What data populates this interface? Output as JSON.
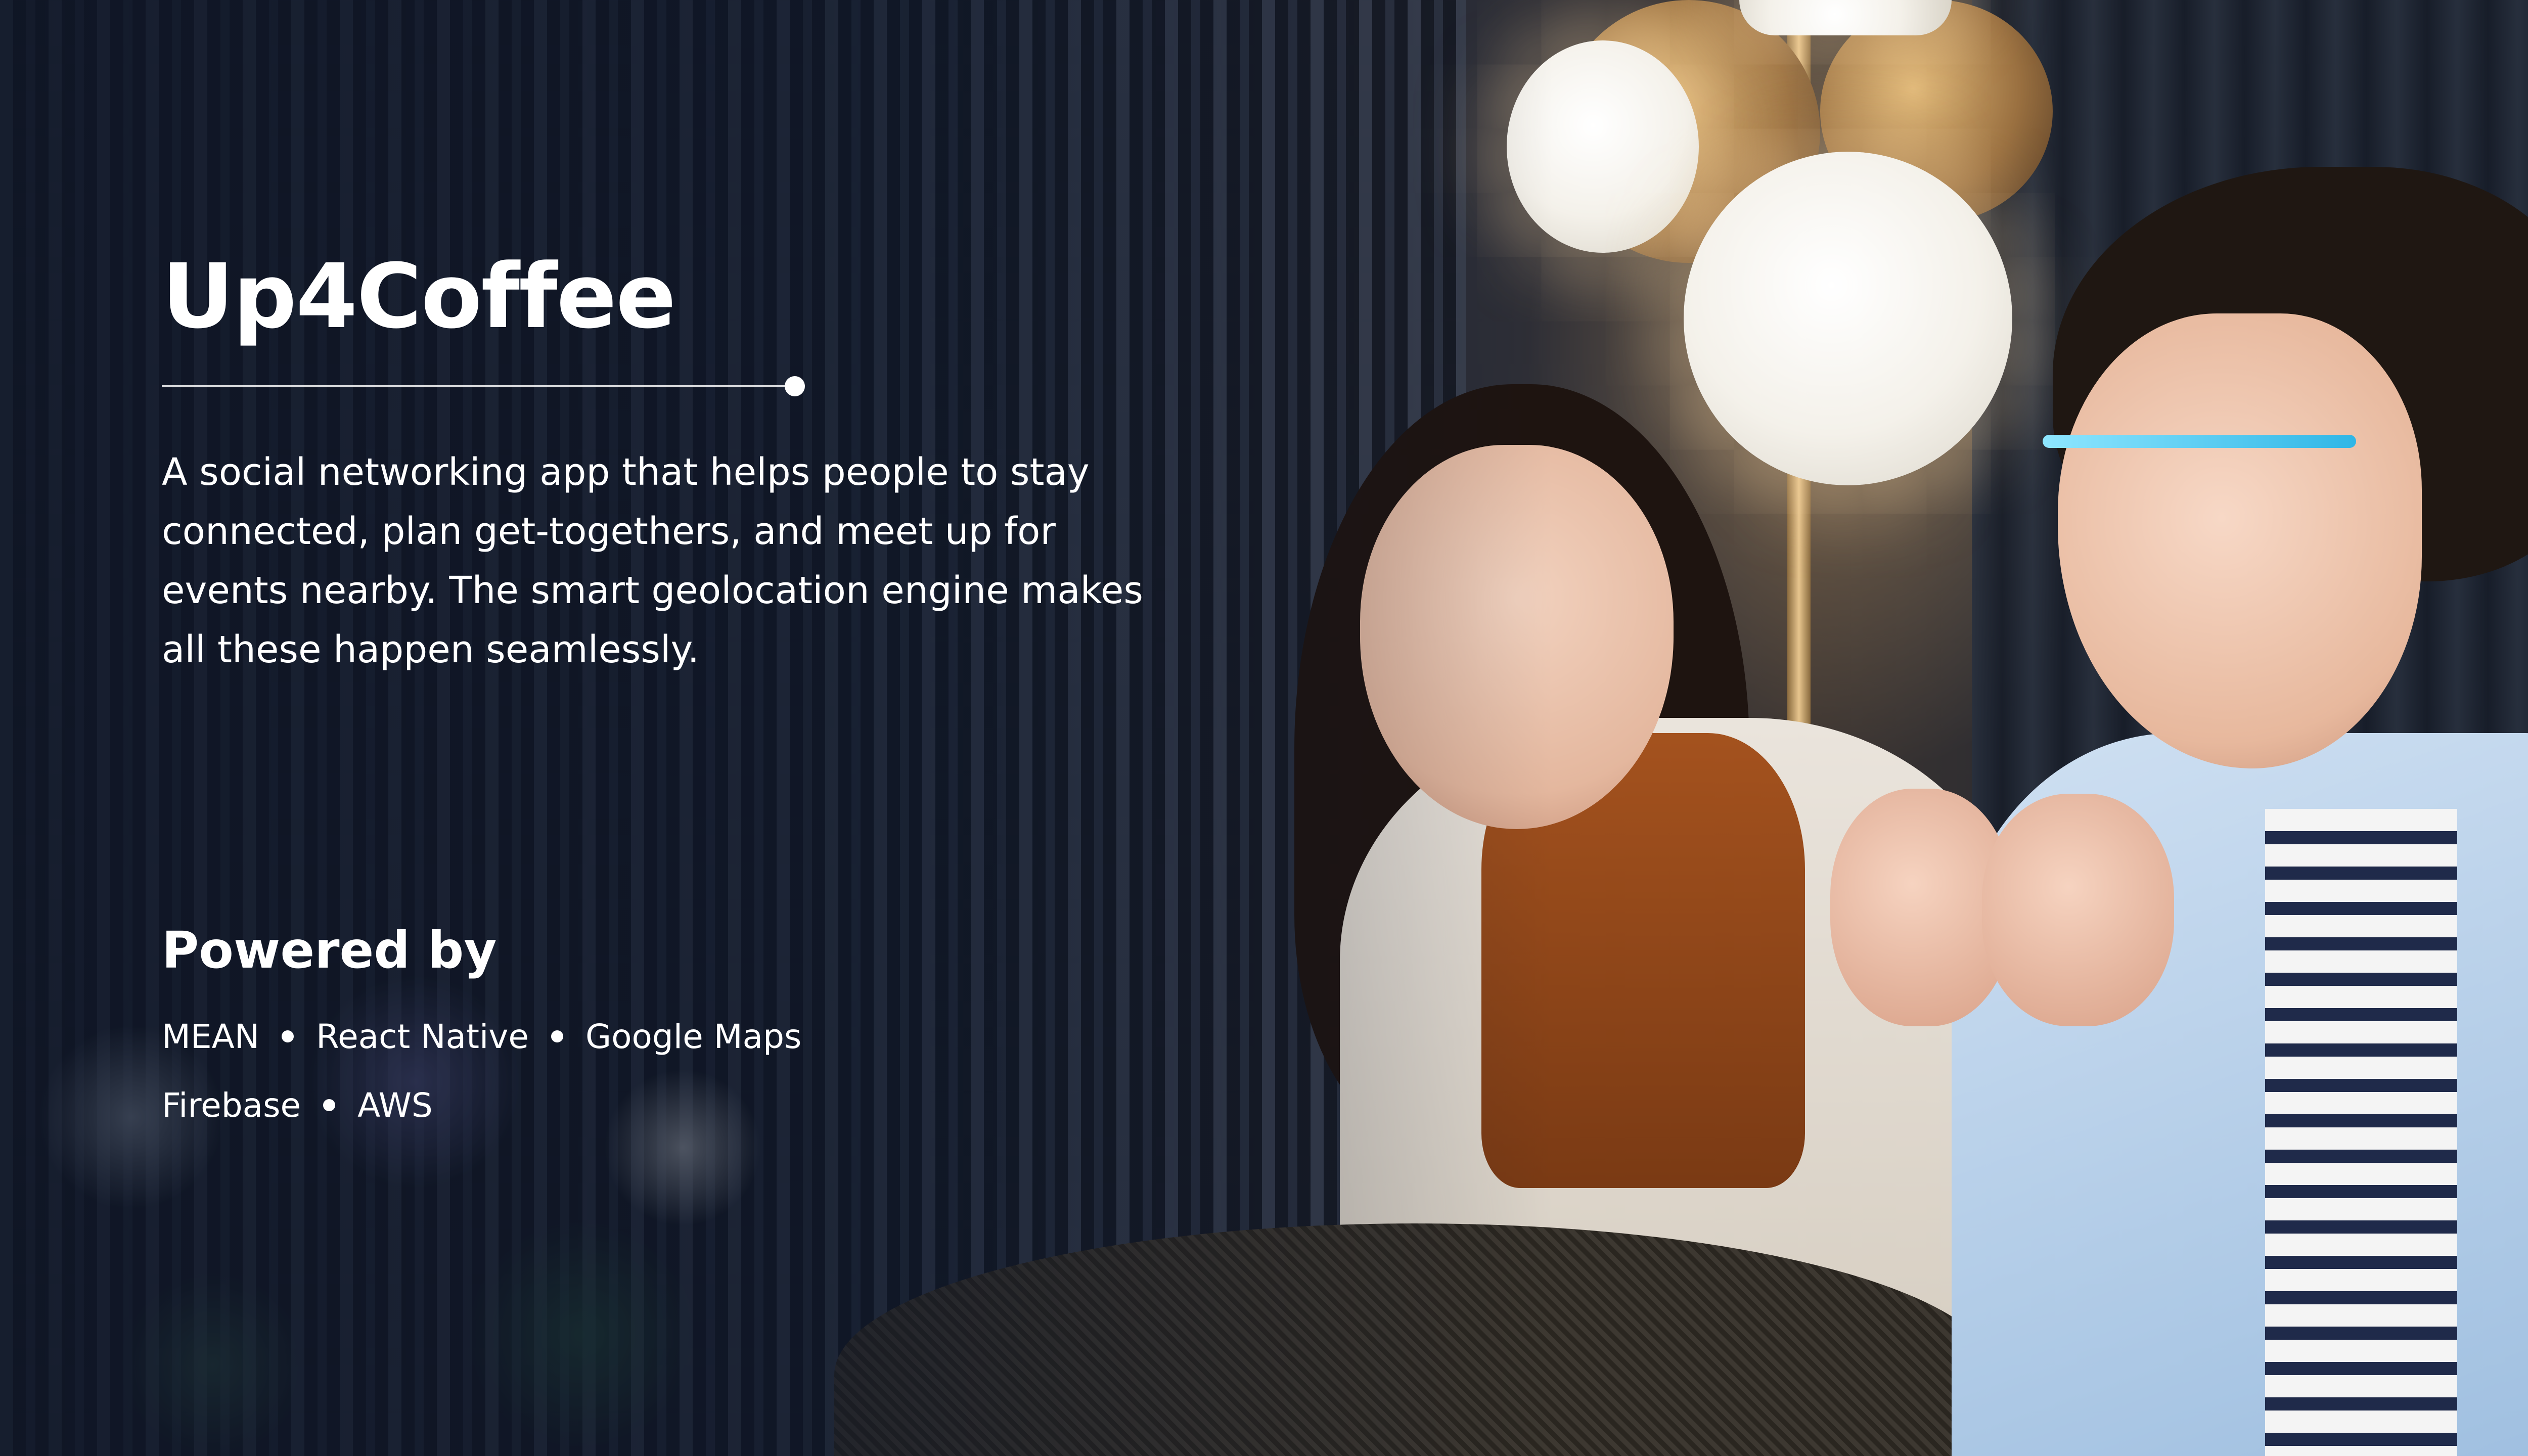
{
  "hero": {
    "title": "Up4Coffee",
    "description": "A social networking app that helps people to stay connected, plan get-togethers, and meet up for events nearby. The smart geolocation engine makes all these happen seamlessly."
  },
  "powered_by": {
    "heading": "Powered by",
    "row1": [
      "MEAN",
      "React Native",
      "Google Maps"
    ],
    "row2": [
      "Firebase",
      "AWS"
    ]
  },
  "colors": {
    "text": "#ffffff",
    "overlay": "#0f1626"
  }
}
